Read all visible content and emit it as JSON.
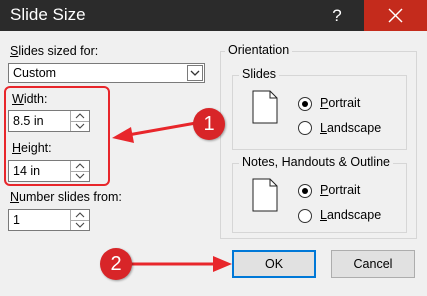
{
  "window": {
    "title": "Slide Size",
    "help": "?"
  },
  "slides_sized_for": {
    "label_u": "S",
    "label_rest": "lides sized for:",
    "value": "Custom"
  },
  "width": {
    "label_u": "W",
    "label_rest": "idth:",
    "value": "8.5 in"
  },
  "height": {
    "label_u": "H",
    "label_rest": "eight:",
    "value": "14 in"
  },
  "number_from": {
    "label_u": "N",
    "label_rest": "umber slides from:",
    "value": "1"
  },
  "orientation": {
    "title": "Orientation",
    "slides": {
      "title": "Slides",
      "portrait": "Portrait",
      "portrait_u": "P",
      "portrait_rest": "ortrait",
      "landscape_u": "L",
      "landscape_rest": "andscape",
      "selected": "Portrait"
    },
    "notes": {
      "title": "Notes, Handouts & Outline",
      "portrait_u": "P",
      "portrait_rest": "ortrait",
      "landscape_u": "L",
      "landscape_rest": "andscape",
      "selected": "Portrait"
    }
  },
  "buttons": {
    "ok": "OK",
    "cancel": "Cancel"
  },
  "annotations": {
    "badge1": "1",
    "badge2": "2"
  },
  "colors": {
    "annotation": "#e8262b",
    "titlebar": "#2b2b2b",
    "close": "#c42b1c"
  }
}
